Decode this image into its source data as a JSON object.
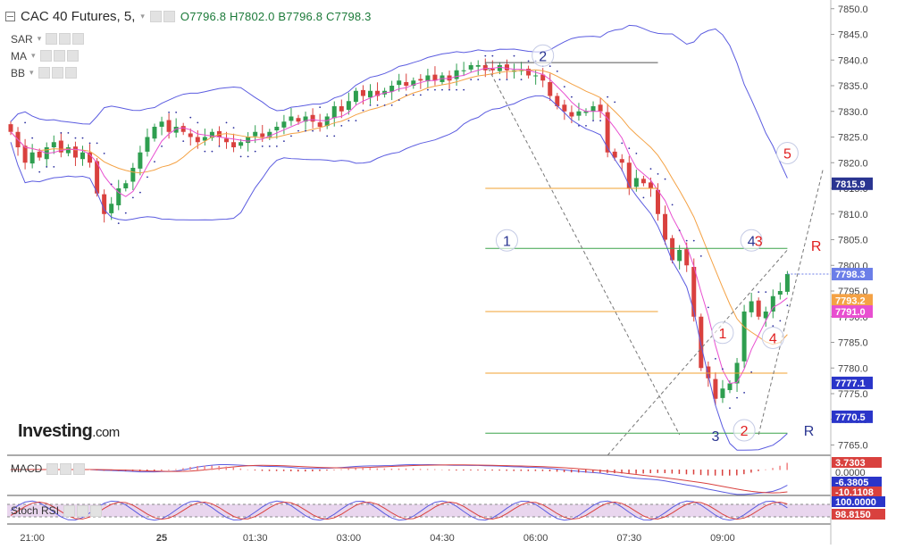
{
  "header": {
    "symbol": "CAC 40 Futures, 5,",
    "open": "O7796.8",
    "high": "H7802.0",
    "low": "B7796.8",
    "close": "C7798.3"
  },
  "indicators": [
    "SAR",
    "MA",
    "BB"
  ],
  "subpanes": {
    "macd_label": "MACD",
    "stoch_label": "Stoch RSI"
  },
  "watermark": {
    "brand": "Investing",
    "suffix": ".com"
  },
  "colors": {
    "up": "#2e9e4f",
    "down": "#d9413e",
    "bollinger": "#5b5ce0",
    "ma_pink": "#e84fd0",
    "ma_orange": "#f4a245",
    "sar": "#2a2e9e",
    "fib_orange": "#f0a030",
    "fib_green": "#3aa34a",
    "elliott_blue": "#2a3591",
    "elliott_red": "#e02020"
  },
  "chart_data": {
    "type": "candlestick",
    "symbol": "CAC 40 Futures",
    "interval": "5",
    "ylim": [
      7763,
      7851
    ],
    "yticks": [
      7765,
      7770,
      7775,
      7780,
      7785,
      7790,
      7795,
      7800,
      7805,
      7810,
      7815,
      7820,
      7825,
      7830,
      7835,
      7840,
      7845,
      7850
    ],
    "x_ticks": [
      {
        "label": "21:00",
        "i": 3
      },
      {
        "label": "25",
        "i": 21
      },
      {
        "label": "01:30",
        "i": 34
      },
      {
        "label": "03:00",
        "i": 47
      },
      {
        "label": "04:30",
        "i": 60
      },
      {
        "label": "06:00",
        "i": 73
      },
      {
        "label": "07:30",
        "i": 86
      },
      {
        "label": "09:00",
        "i": 99
      }
    ],
    "closes": [
      7826,
      7823,
      7820,
      7822,
      7821,
      7823,
      7824,
      7822,
      7823,
      7821,
      7822,
      7820,
      7814,
      7810,
      7812,
      7815,
      7816,
      7819,
      7822,
      7825,
      7827,
      7828,
      7826,
      7827,
      7826,
      7825,
      7824,
      7825,
      7826,
      7825,
      7824,
      7823,
      7824,
      7825,
      7826,
      7825,
      7826,
      7827,
      7828,
      7829,
      7828,
      7829,
      7828,
      7827,
      7829,
      7831,
      7830,
      7832,
      7834,
      7833,
      7834,
      7833,
      7834,
      7835,
      7836,
      7835,
      7836,
      7836,
      7837,
      7836,
      7837,
      7836,
      7838,
      7838,
      7839,
      7839,
      7838,
      7838,
      7839,
      7838,
      7838,
      7838,
      7837,
      7837,
      7836,
      7833,
      7831,
      7830,
      7829,
      7830,
      7830,
      7831,
      7830,
      7822,
      7821,
      7820,
      7815,
      7817,
      7816,
      7815,
      7810,
      7805,
      7801,
      7803,
      7800,
      7790,
      7780,
      7778,
      7774,
      7776,
      7777,
      7781,
      7791,
      7793,
      7790,
      7791,
      7794,
      7795,
      7798.3
    ],
    "current_price": 7798.3,
    "price_badges": [
      {
        "label": "7815.9",
        "value": 7815.9,
        "color": "#2a3591"
      },
      {
        "label": "7798.3",
        "value": 7798.3,
        "color": "#6b7ee8"
      },
      {
        "label": "7793.2",
        "value": 7793.2,
        "color": "#f4a245"
      },
      {
        "label": "7791.0",
        "value": 7791.0,
        "color": "#e84fd0"
      },
      {
        "label": "7777.1",
        "value": 7777.1,
        "color": "#2a35c9"
      },
      {
        "label": "7770.5",
        "value": 7770.5,
        "color": "#2a35c9"
      }
    ],
    "fib_levels": [
      {
        "value": 7839.5,
        "color": "#555555",
        "x_from": 66,
        "x_to": 90
      },
      {
        "value": 7815,
        "color": "#f0a030",
        "x_from": 66,
        "x_to": 90
      },
      {
        "value": 7803.3,
        "color": "#3aa34a",
        "x_from": 66,
        "x_to": 108
      },
      {
        "value": 7791,
        "color": "#f0a030",
        "x_from": 66,
        "x_to": 90
      },
      {
        "value": 7779,
        "color": "#f0a030",
        "x_from": 66,
        "x_to": 108
      },
      {
        "value": 7767.3,
        "color": "#3aa34a",
        "x_from": 66,
        "x_to": 108
      }
    ],
    "wave_labels": [
      {
        "text": "1",
        "i": 69,
        "value": 7804,
        "color": "#2a3591",
        "circle": true
      },
      {
        "text": "2",
        "i": 74,
        "value": 7840,
        "color": "#2a3591",
        "circle": true
      },
      {
        "text": "3",
        "i": 98,
        "value": 7766,
        "color": "#2a3591",
        "circle": false
      },
      {
        "text": "4",
        "i": 103,
        "value": 7804,
        "color": "#2a3591",
        "circle": true
      },
      {
        "text": "1",
        "i": 99,
        "value": 7786,
        "color": "#e02020",
        "circle": true
      },
      {
        "text": "2",
        "i": 102,
        "value": 7767,
        "color": "#e02020",
        "circle": true
      },
      {
        "text": "3",
        "i": 104,
        "value": 7804,
        "color": "#e02020",
        "circle": false
      },
      {
        "text": "4",
        "i": 106,
        "value": 7785,
        "color": "#e02020",
        "circle": true
      },
      {
        "text": "5",
        "i": 108,
        "value": 7821,
        "color": "#e02020",
        "circle": true
      },
      {
        "text": "R",
        "i": 112,
        "value": 7803,
        "color": "#e02020",
        "circle": false
      },
      {
        "text": "R",
        "i": 111,
        "value": 7767,
        "color": "#2a3591",
        "circle": false
      }
    ],
    "macd": {
      "badges": [
        {
          "label": "3.7303",
          "value": 3.73,
          "color": "#d9413e"
        },
        {
          "label": "0.0000",
          "value": 0,
          "color": null
        },
        {
          "label": "-6.3805",
          "value": -6.38,
          "color": "#2a35c9"
        },
        {
          "label": "-10.1108",
          "value": -10.11,
          "color": "#d9413e"
        }
      ]
    },
    "stoch_rsi": {
      "badges": [
        {
          "label": "100.0000",
          "value": 100,
          "color": "#2a35c9"
        },
        {
          "label": "98.8150",
          "value": 98.815,
          "color": "#d9413e"
        }
      ]
    }
  }
}
